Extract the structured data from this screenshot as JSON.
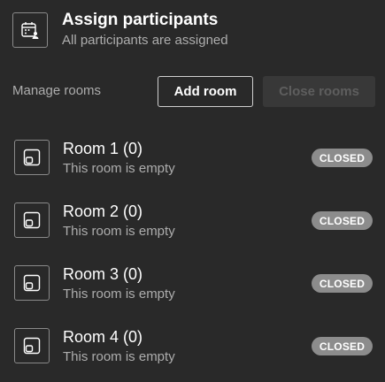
{
  "header": {
    "icon": "calendar-people-icon",
    "title": "Assign participants",
    "subtitle": "All participants are assigned"
  },
  "manage": {
    "label": "Manage rooms",
    "add_room_label": "Add room",
    "close_rooms_label": "Close rooms"
  },
  "rooms": [
    {
      "name": "Room 1 (0)",
      "status": "This room is empty",
      "badge": "CLOSED",
      "icon": "room-icon"
    },
    {
      "name": "Room 2 (0)",
      "status": "This room is empty",
      "badge": "CLOSED",
      "icon": "room-icon"
    },
    {
      "name": "Room 3 (0)",
      "status": "This room is empty",
      "badge": "CLOSED",
      "icon": "room-icon"
    },
    {
      "name": "Room 4 (0)",
      "status": "This room is empty",
      "badge": "CLOSED",
      "icon": "room-icon"
    }
  ],
  "colors": {
    "background": "#292929",
    "badge": "#8c8c8c",
    "secondary_text": "#adadad",
    "disabled_button": "#383838"
  }
}
